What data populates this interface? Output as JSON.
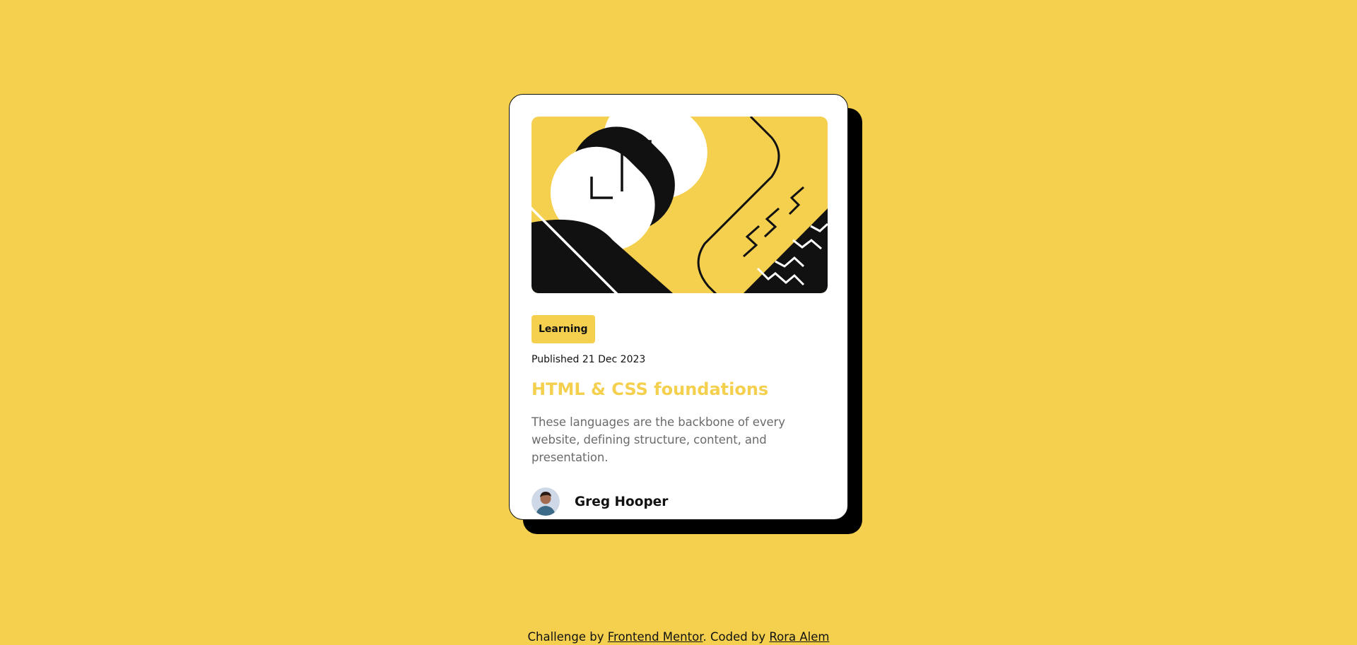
{
  "card": {
    "tag": "Learning",
    "published": "Published 21 Dec 2023",
    "title": "HTML & CSS foundations",
    "description": "These languages are the backbone of every website, defining structure, content, and presentation.",
    "author_name": "Greg Hooper",
    "hero_icon": "abstract-illustration",
    "avatar_icon": "author-avatar"
  },
  "footer": {
    "prefix": "Challenge by ",
    "link1": "Frontend Mentor",
    "middle": ". Coded by ",
    "link2": "Rora Alem"
  },
  "colors": {
    "background": "#f4d04e",
    "card": "#ffffff",
    "text": "#111111",
    "muted": "#6b6b6b",
    "accent": "#f4d04e"
  }
}
